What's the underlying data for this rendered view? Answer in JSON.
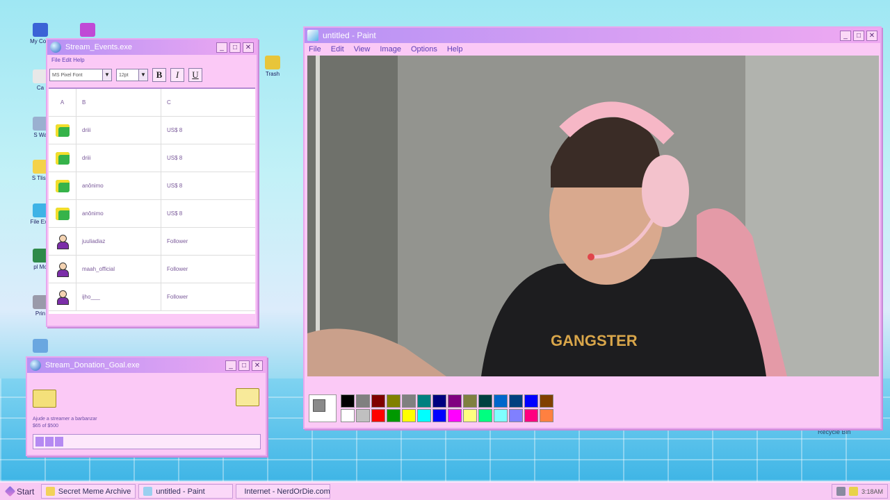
{
  "desktop": {
    "icons": [
      {
        "label": "My Com",
        "color": "#3b63d6"
      },
      {
        "label": "",
        "color": "#c04ad6"
      },
      {
        "label": "Ca",
        "color": "#e8e8e8"
      },
      {
        "label": "S Wa",
        "color": "#9ab0d0"
      },
      {
        "label": "S Tlish",
        "color": "#f4d24a"
      },
      {
        "label": "File Exp",
        "color": "#3fb3e6"
      },
      {
        "label": "pl Mo",
        "color": "#2f8a4a"
      },
      {
        "label": "Prin",
        "color": "#9a9aaa"
      },
      {
        "label": "",
        "color": "#6aa7e0"
      },
      {
        "label": "Trash",
        "color": "#e8c53a"
      }
    ],
    "recycle_bin": "Recycle Bin"
  },
  "events_window": {
    "title": "Stream_Events.exe",
    "menu": "File Edit Help",
    "font_select": "MS Pixel Font",
    "size_select": "12pt",
    "bold": "B",
    "italic": "I",
    "underline": "U",
    "headers": [
      "A",
      "B",
      "C"
    ],
    "rows": [
      {
        "icon": "money-icon",
        "name": "driii",
        "value": "US$ 8"
      },
      {
        "icon": "money-icon",
        "name": "driii",
        "value": "US$ 8"
      },
      {
        "icon": "money-icon",
        "name": "anônimo",
        "value": "US$ 8"
      },
      {
        "icon": "money-icon",
        "name": "anônimo",
        "value": "US$ 8"
      },
      {
        "icon": "user-icon",
        "name": "juuliadiaz",
        "value": "Follower"
      },
      {
        "icon": "user-icon",
        "name": "maah_official",
        "value": "Follower"
      },
      {
        "icon": "user-icon",
        "name": "ijho___",
        "value": "Follower"
      }
    ]
  },
  "donation_window": {
    "title": "Stream_Donation_Goal.exe",
    "line1": "Ajude a streamer a barbanzar",
    "line2": "$65 of $500",
    "progress": 0.13
  },
  "paint_window": {
    "title": "untitled - Paint",
    "menu": [
      "File",
      "Edit",
      "View",
      "Image",
      "Options",
      "Help"
    ],
    "canvas_label": "GANGSTER",
    "palette_top": [
      "#000000",
      "#808080",
      "#800000",
      "#808000",
      "#808080",
      "#008080",
      "#000080",
      "#800080",
      "#808040",
      "#004040",
      "#0066cc",
      "#004080",
      "#0000ff",
      "#804000"
    ],
    "palette_bottom": [
      "#ffffff",
      "#c0c0c0",
      "#ff0000",
      "#009900",
      "#ffff00",
      "#00ffff",
      "#0000ff",
      "#ff00ff",
      "#ffff80",
      "#00ff80",
      "#80ffff",
      "#8080ff",
      "#ff0080",
      "#ff8040"
    ]
  },
  "taskbar": {
    "start": "Start",
    "tasks": [
      "Secret Meme Archive",
      "untitled - Paint",
      "Internet - NerdOrDie.com"
    ],
    "clock": "3:18AM"
  }
}
